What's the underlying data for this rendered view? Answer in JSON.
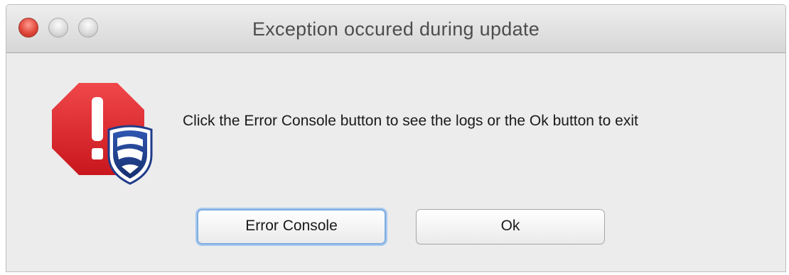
{
  "window": {
    "title": "Exception occured during update"
  },
  "dialog": {
    "message": "Click the Error Console button to see the logs or the Ok button to exit",
    "icon": "error-stop-sign-icon",
    "badge_icon": "bank-shield-logo-icon"
  },
  "buttons": {
    "error_console": "Error Console",
    "ok": "Ok"
  },
  "colors": {
    "stop_sign_red": "#e0242a",
    "shield_blue": "#1f3b8a",
    "focus_ring": "#7eaee0"
  }
}
